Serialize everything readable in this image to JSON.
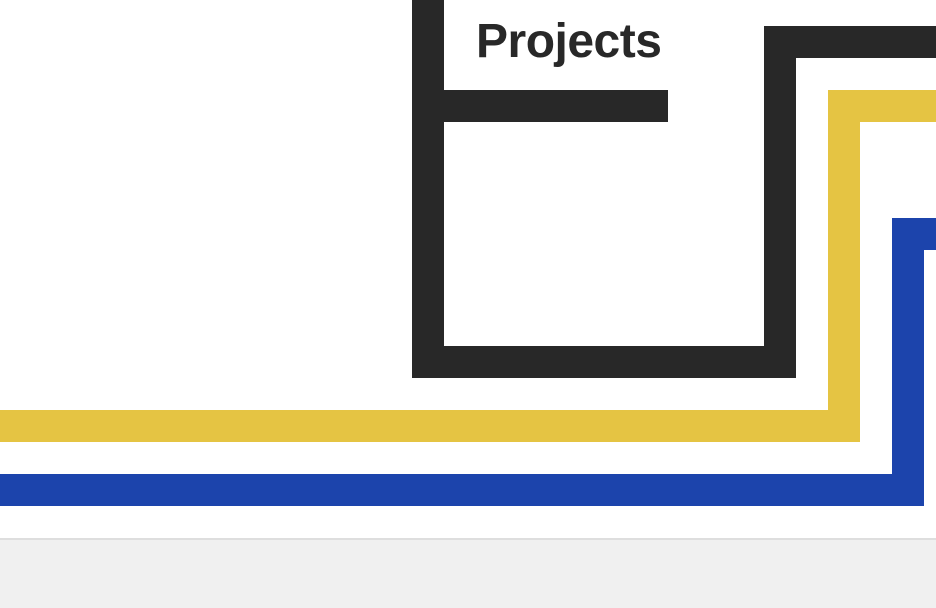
{
  "header": {
    "title": "Projects"
  },
  "colors": {
    "dark_line": "#282828",
    "yellow_line": "#e5c443",
    "blue_line": "#1c44ac",
    "background": "#ffffff",
    "footer_background": "#f0f0f0",
    "footer_border": "#dedede"
  }
}
